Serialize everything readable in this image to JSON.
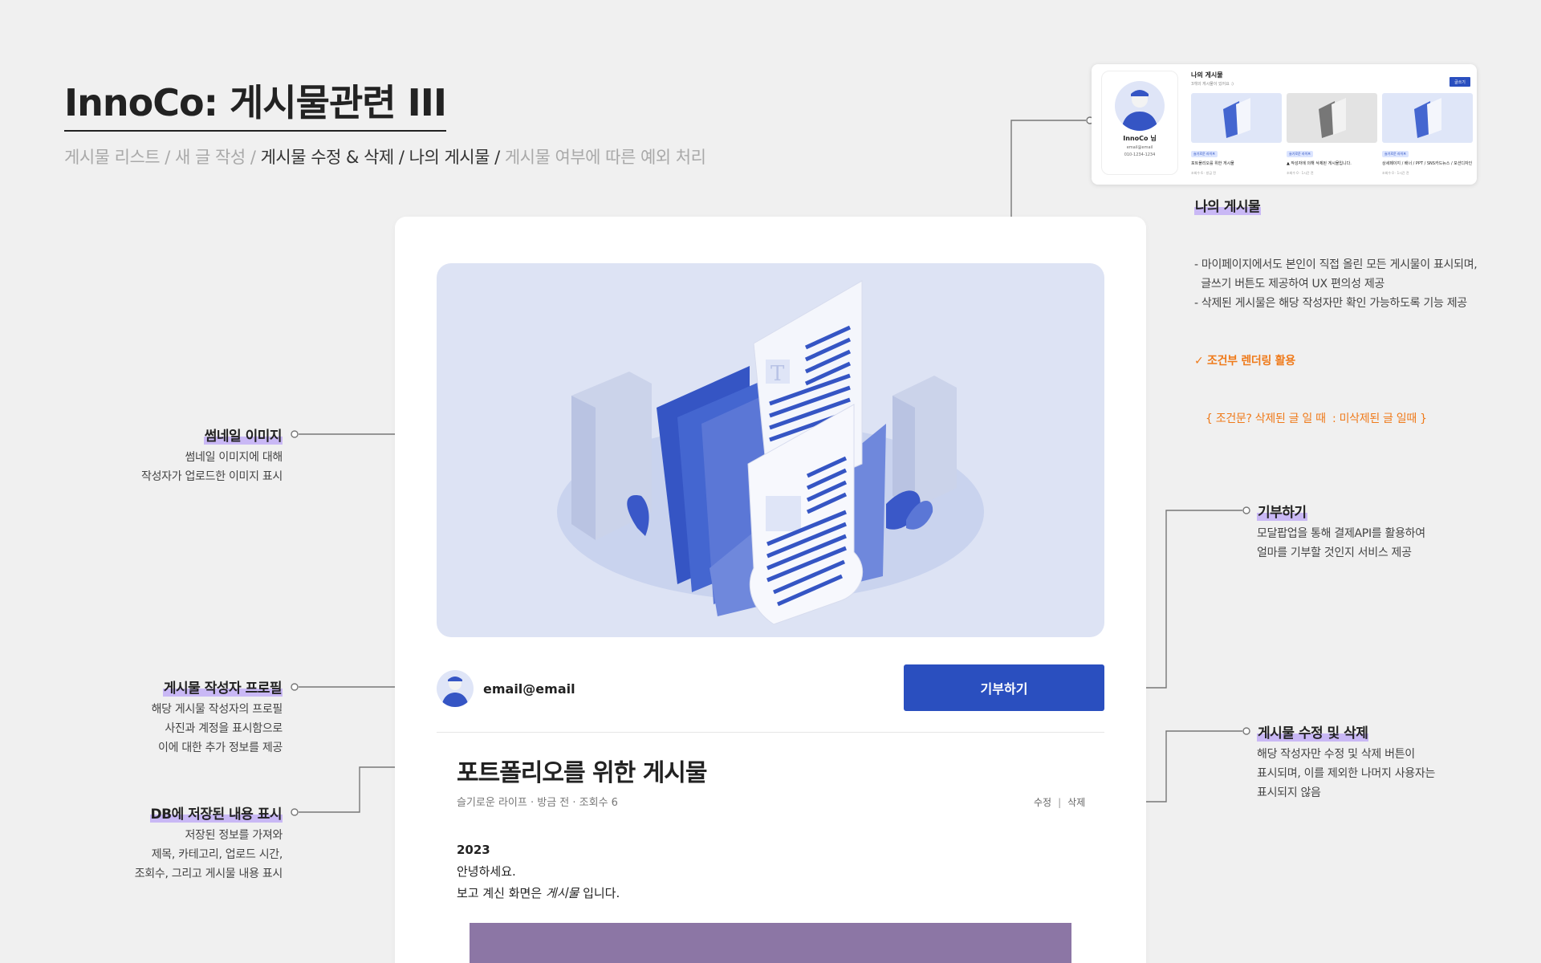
{
  "header": {
    "title": "InnoCo: 게시물관련 III",
    "crumbs": [
      {
        "label": "게시물 리스트 / 새 글 작성 / ",
        "active": false
      },
      {
        "label": "게시물 수정 & 삭제 / 나의 게시물 / ",
        "active": true
      },
      {
        "label": "게시물 여부에 따른 예외 처리",
        "active": false
      }
    ]
  },
  "post": {
    "author_email": "email@email",
    "donate_label": "기부하기",
    "title": "포트폴리오를 위한 게시물",
    "meta": "슬기로운 라이프 · 방금 전 · 조회수 6",
    "edit_label": "수정",
    "separator": "|",
    "delete_label": "삭제",
    "body_year": "2023",
    "body_line1": "안녕하세요.",
    "body_line2_pre": "보고 계신 화면은 ",
    "body_line2_em": "게시물",
    "body_line2_post": " 입니다."
  },
  "annotations": {
    "thumbnail": {
      "title": "썸네일 이미지",
      "desc": [
        "썸네일 이미지에 대해",
        "작성자가 업로드한 이미지 표시"
      ]
    },
    "author": {
      "title": "게시물 작성자 프로필",
      "desc": [
        "해당 게시물 작성자의 프로필",
        "사진과  계정을 표시함으로",
        "이에 대한 추가 정보를 제공"
      ]
    },
    "db": {
      "title": "DB에 저장된 내용 표시",
      "desc": [
        "저장된 정보를 가져와",
        "제목, 카테고리, 업로드 시간,",
        "조회수, 그리고 게시물 내용 표시"
      ]
    },
    "donate": {
      "title": "기부하기",
      "desc": [
        "모달팝업을 통해 결제API를 활용하여",
        "얼마를 기부할 것인지 서비스 제공"
      ]
    },
    "edit_delete": {
      "title": "게시물 수정 및 삭제",
      "desc": [
        "해당 작성자만 수정 및 삭제 버튼이",
        "표시되며, 이를 제외한 나머지 사용자는",
        "표시되지 않음"
      ]
    },
    "my_posts": {
      "title": "나의 게시물",
      "desc": [
        "- 마이페이지에서도 본인이 직접 올린 모든 게시물이 표시되며,",
        "  글쓰기 버튼도 제공하여 UX 편의성 제공",
        "- 삭제된 게시물은 해당 작성자만 확인 가능하도록 기능 제공"
      ],
      "highlight1": "✓ 조건부 렌더링 활용",
      "highlight2": "{ 조건문? 삭제된 글 일 때  : 미삭제된 글 일때 }"
    }
  },
  "mini": {
    "name": "InnoCo 님",
    "email": "email@email",
    "phone": "010-1234-1234",
    "heading": "나의 게시물",
    "sub": "3개의 게시물이 있어요 :)",
    "write_label": "글쓰기",
    "cards": [
      {
        "badge": "슬기로운 라이프",
        "caption": "포트폴리오를 위한 게시물",
        "footer": "조회수 6 · 방금 전",
        "gray": false
      },
      {
        "badge": "슬기로운 라이프",
        "caption": "▲ 작성자에 의해 삭제된 게시물입니다.",
        "footer": "조회수 0 · 1시간 전",
        "gray": true
      },
      {
        "badge": "슬기로운 라이프",
        "caption": "상세페이지 / 배너 / PPT / SNS카드뉴스 / 모션디자인",
        "footer": "조회수 0 · 1시간 전",
        "gray": false
      }
    ]
  },
  "colors": {
    "accent": "#2a4fbf",
    "highlight": "#c9b8f5",
    "orange": "#ef7a1a",
    "thumb_bg": "#dde3f4"
  }
}
